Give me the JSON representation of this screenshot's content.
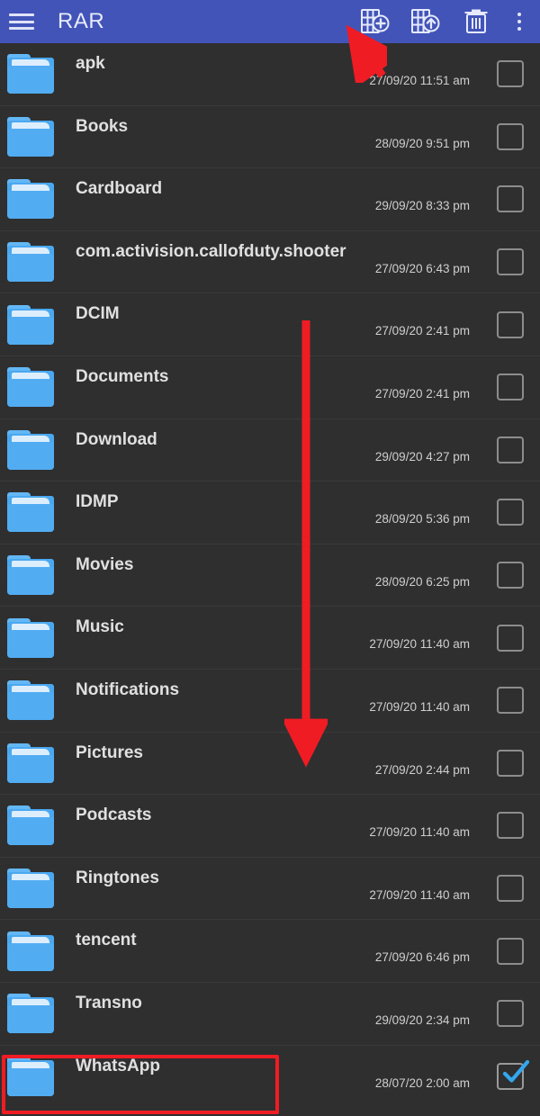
{
  "toolbar": {
    "menu_icon": "hamburger-menu-icon",
    "title": "RAR",
    "actions": [
      {
        "icon": "add-to-archive-icon",
        "label": "Add to archive"
      },
      {
        "icon": "extract-archive-icon",
        "label": "Extract files"
      },
      {
        "icon": "delete-trash-icon",
        "label": "Delete"
      },
      {
        "icon": "overflow-menu-icon",
        "label": "More options"
      }
    ],
    "accent_color": "#4254b8",
    "title_color": "#e8ebfb"
  },
  "annotations": {
    "arrow_color": "#f01c24",
    "highlight_color": "#f01c24",
    "top_arrow": "points-to-add-to-archive-button",
    "down_arrow": "scroll-down-indicator",
    "highlight_target": "WhatsApp"
  },
  "list": {
    "background": "#2f2f2f",
    "rows": [
      {
        "name": "apk",
        "date": "27/09/20 11:51 am",
        "checked": false
      },
      {
        "name": "Books",
        "date": "28/09/20 9:51 pm",
        "checked": false
      },
      {
        "name": "Cardboard",
        "date": "29/09/20 8:33 pm",
        "checked": false
      },
      {
        "name": "com.activision.callofduty.shooter",
        "date": "27/09/20 6:43 pm",
        "checked": false
      },
      {
        "name": "DCIM",
        "date": "27/09/20 2:41 pm",
        "checked": false
      },
      {
        "name": "Documents",
        "date": "27/09/20 2:41 pm",
        "checked": false
      },
      {
        "name": "Download",
        "date": "29/09/20 4:27 pm",
        "checked": false
      },
      {
        "name": "IDMP",
        "date": "28/09/20 5:36 pm",
        "checked": false
      },
      {
        "name": "Movies",
        "date": "28/09/20 6:25 pm",
        "checked": false
      },
      {
        "name": "Music",
        "date": "27/09/20 11:40 am",
        "checked": false
      },
      {
        "name": "Notifications",
        "date": "27/09/20 11:40 am",
        "checked": false
      },
      {
        "name": "Pictures",
        "date": "27/09/20 2:44 pm",
        "checked": false
      },
      {
        "name": "Podcasts",
        "date": "27/09/20 11:40 am",
        "checked": false
      },
      {
        "name": "Ringtones",
        "date": "27/09/20 11:40 am",
        "checked": false
      },
      {
        "name": "tencent",
        "date": "27/09/20 6:46 pm",
        "checked": false
      },
      {
        "name": "Transno",
        "date": "29/09/20 2:34 pm",
        "checked": false
      },
      {
        "name": "WhatsApp",
        "date": "28/07/20 2:00 am",
        "checked": true
      }
    ]
  }
}
